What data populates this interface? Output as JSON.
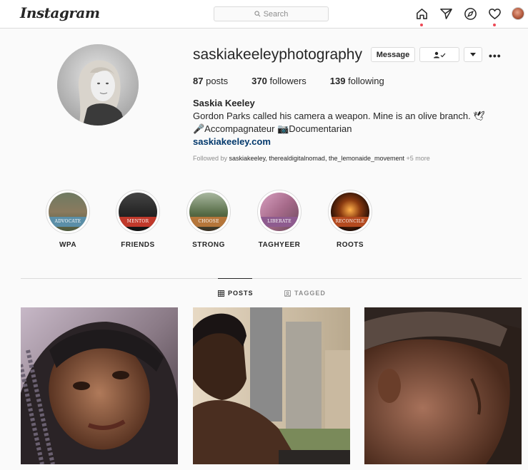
{
  "nav": {
    "logo": "Instagram",
    "search_placeholder": "Search",
    "icons": [
      "home-icon",
      "direct-icon",
      "explore-icon",
      "activity-icon",
      "profile-avatar"
    ]
  },
  "profile": {
    "username": "saskiakeeleyphotography",
    "message_label": "Message",
    "stats": {
      "posts_count": "87",
      "posts_label": "posts",
      "followers_count": "370",
      "followers_label": "followers",
      "following_count": "139",
      "following_label": "following"
    },
    "full_name": "Saskia Keeley",
    "bio_line1": "Gordon Parks called his camera a weapon. Mine is an olive branch. 🕊",
    "bio_line2": "🎤Accompagnateur 📷Documentarian",
    "website": "saskiakeeley.com",
    "followed_by_prefix": "Followed by ",
    "followed_by_names": "saskiakeeley, therealdigitalnomad, the_lemonaide_movement",
    "followed_by_more": " +5 more"
  },
  "highlights": [
    {
      "label": "WPA",
      "band": "ADVOCATE",
      "band_color": "#5b8fa8"
    },
    {
      "label": "FRIENDS",
      "band": "MENTOR",
      "band_color": "#c0392b"
    },
    {
      "label": "STRONG",
      "band": "CHOOSE",
      "band_color": "#b5763a"
    },
    {
      "label": "TAGHYEER",
      "band": "LIBERATE",
      "band_color": "#8e5b8f"
    },
    {
      "label": "ROOTS",
      "band": "RECONCILE",
      "band_color": "#b44a1f"
    }
  ],
  "tabs": {
    "posts": "POSTS",
    "tagged": "TAGGED"
  },
  "colors": {
    "accent_link": "#00376b",
    "notification_dot": "#ed4956",
    "border": "#dbdbdb"
  }
}
